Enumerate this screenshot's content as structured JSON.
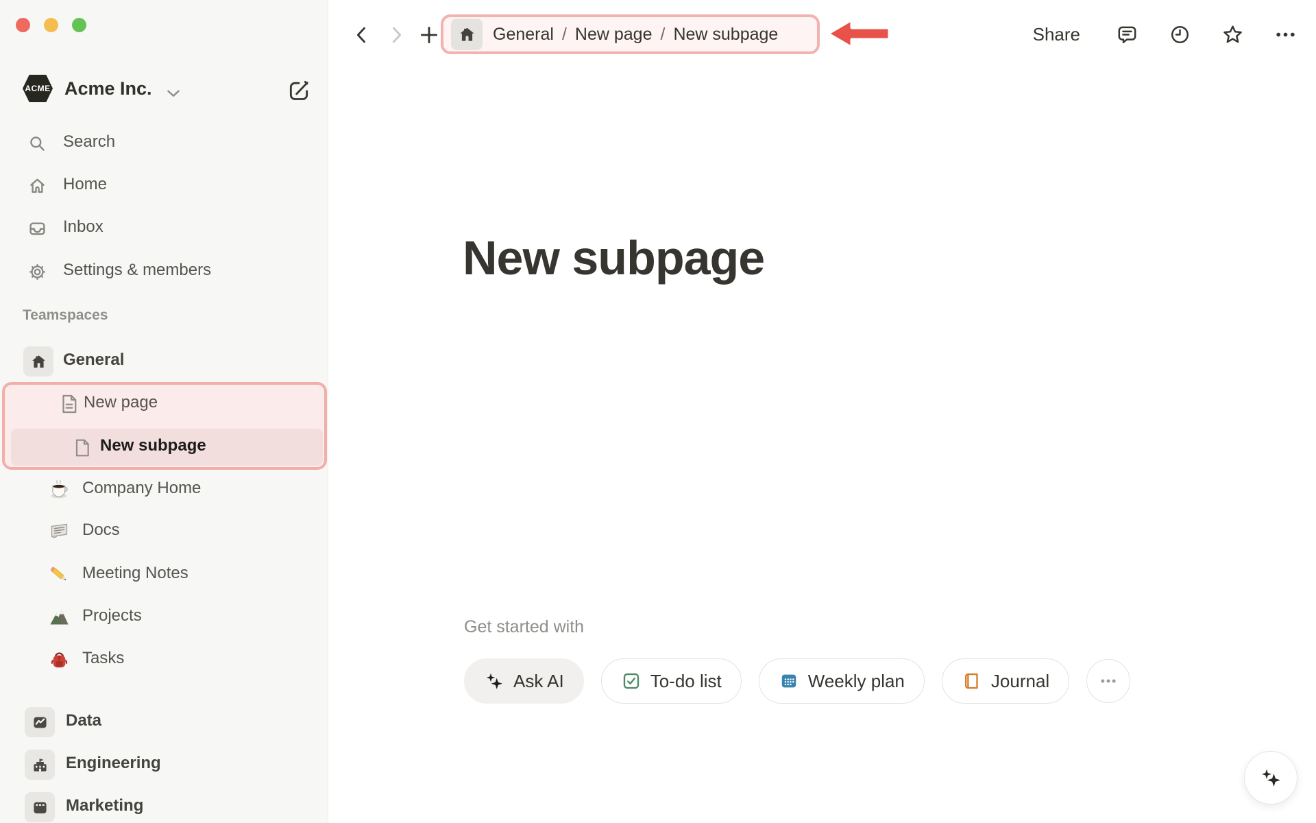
{
  "window": {
    "controls": [
      "close",
      "minimize",
      "zoom"
    ]
  },
  "colors": {
    "sidebar_bg": "#f7f7f5",
    "main_bg": "#ffffff",
    "text_primary": "#37352f",
    "text_secondary": "#55534e",
    "text_muted": "#8f8e8a",
    "annotation_border": "#f1aeab",
    "annotation_fill": "#fbebea",
    "selected_row_fill": "#f2dedd",
    "arrow_red": "#e8524a",
    "todo_green": "#4d8a66",
    "calendar_blue": "#3884ae",
    "journal_orange": "#d87d2c"
  },
  "sidebar": {
    "workspace": {
      "name": "Acme Inc.",
      "logo_text": "ACME",
      "logo_icon": "acme-hexagon-logo",
      "actions": [
        "chevron-down-icon",
        "compose-icon"
      ]
    },
    "nav": [
      {
        "icon": "search-icon",
        "label": "Search"
      },
      {
        "icon": "home-icon",
        "label": "Home"
      },
      {
        "icon": "inbox-icon",
        "label": "Inbox"
      },
      {
        "icon": "gear-icon",
        "label": "Settings & members"
      }
    ],
    "teamspaces_label": "Teamspaces",
    "general": {
      "icon": "house-badge-icon",
      "label": "General"
    },
    "pages": [
      {
        "icon": "document-icon",
        "label": "New page",
        "level": 1,
        "highlighted": true
      },
      {
        "icon": "blank-page-icon",
        "label": "New subpage",
        "level": 2,
        "selected": true
      }
    ],
    "general_children": [
      {
        "icon": "coffee-icon",
        "label": "Company Home"
      },
      {
        "icon": "newspaper-icon",
        "label": "Docs"
      },
      {
        "icon": "pencil-icon",
        "label": "Meeting Notes"
      },
      {
        "icon": "mountain-icon",
        "label": "Projects"
      },
      {
        "icon": "backpack-icon",
        "label": "Tasks"
      }
    ],
    "other_teamspaces": [
      {
        "icon": "chart-badge-icon",
        "label": "Data"
      },
      {
        "icon": "school-badge-icon",
        "label": "Engineering"
      },
      {
        "icon": "board-badge-icon",
        "label": "Marketing"
      }
    ]
  },
  "topbar": {
    "nav_icons": [
      "back-chevron-icon",
      "forward-chevron-icon",
      "plus-icon"
    ],
    "breadcrumb": {
      "icon": "home-badge-icon",
      "items": [
        "General",
        "New page",
        "New subpage"
      ],
      "separator": "/"
    },
    "annotation": "red-arrow pointing at breadcrumb",
    "share_label": "Share",
    "right_icons": [
      "comment-icon",
      "history-clock-icon",
      "favorite-star-icon",
      "more-ellipsis-icon"
    ]
  },
  "main": {
    "title": "New subpage",
    "get_started_label": "Get started with",
    "actions": [
      {
        "icon": "sparkles-icon",
        "label": "Ask AI",
        "style": "gray"
      },
      {
        "icon": "todo-checkbox-icon",
        "label": "To-do list"
      },
      {
        "icon": "calendar-icon",
        "label": "Weekly plan"
      },
      {
        "icon": "journal-book-icon",
        "label": "Journal"
      }
    ],
    "more_actions_icon": "ellipsis-icon",
    "fab_icon": "ai-sparkles-icon"
  }
}
